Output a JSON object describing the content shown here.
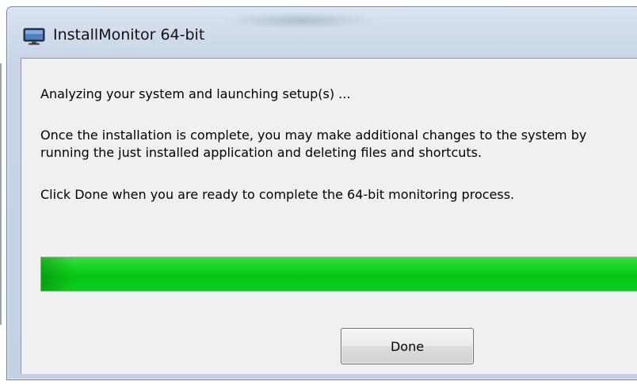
{
  "window": {
    "title": "InstallMonitor 64-bit",
    "icon": "monitor-icon"
  },
  "messages": {
    "status": "Analyzing your system and launching setup(s) ...",
    "info_line1": "Once the installation is complete, you may make additional changes to the system by",
    "info_line2": "running the just installed application and deleting files and shortcuts.",
    "instruction": "Click Done when you are ready to complete the 64-bit monitoring process."
  },
  "progress": {
    "fraction": 1.0,
    "color": "#0fcf1c"
  },
  "buttons": {
    "done_label": "Done"
  }
}
